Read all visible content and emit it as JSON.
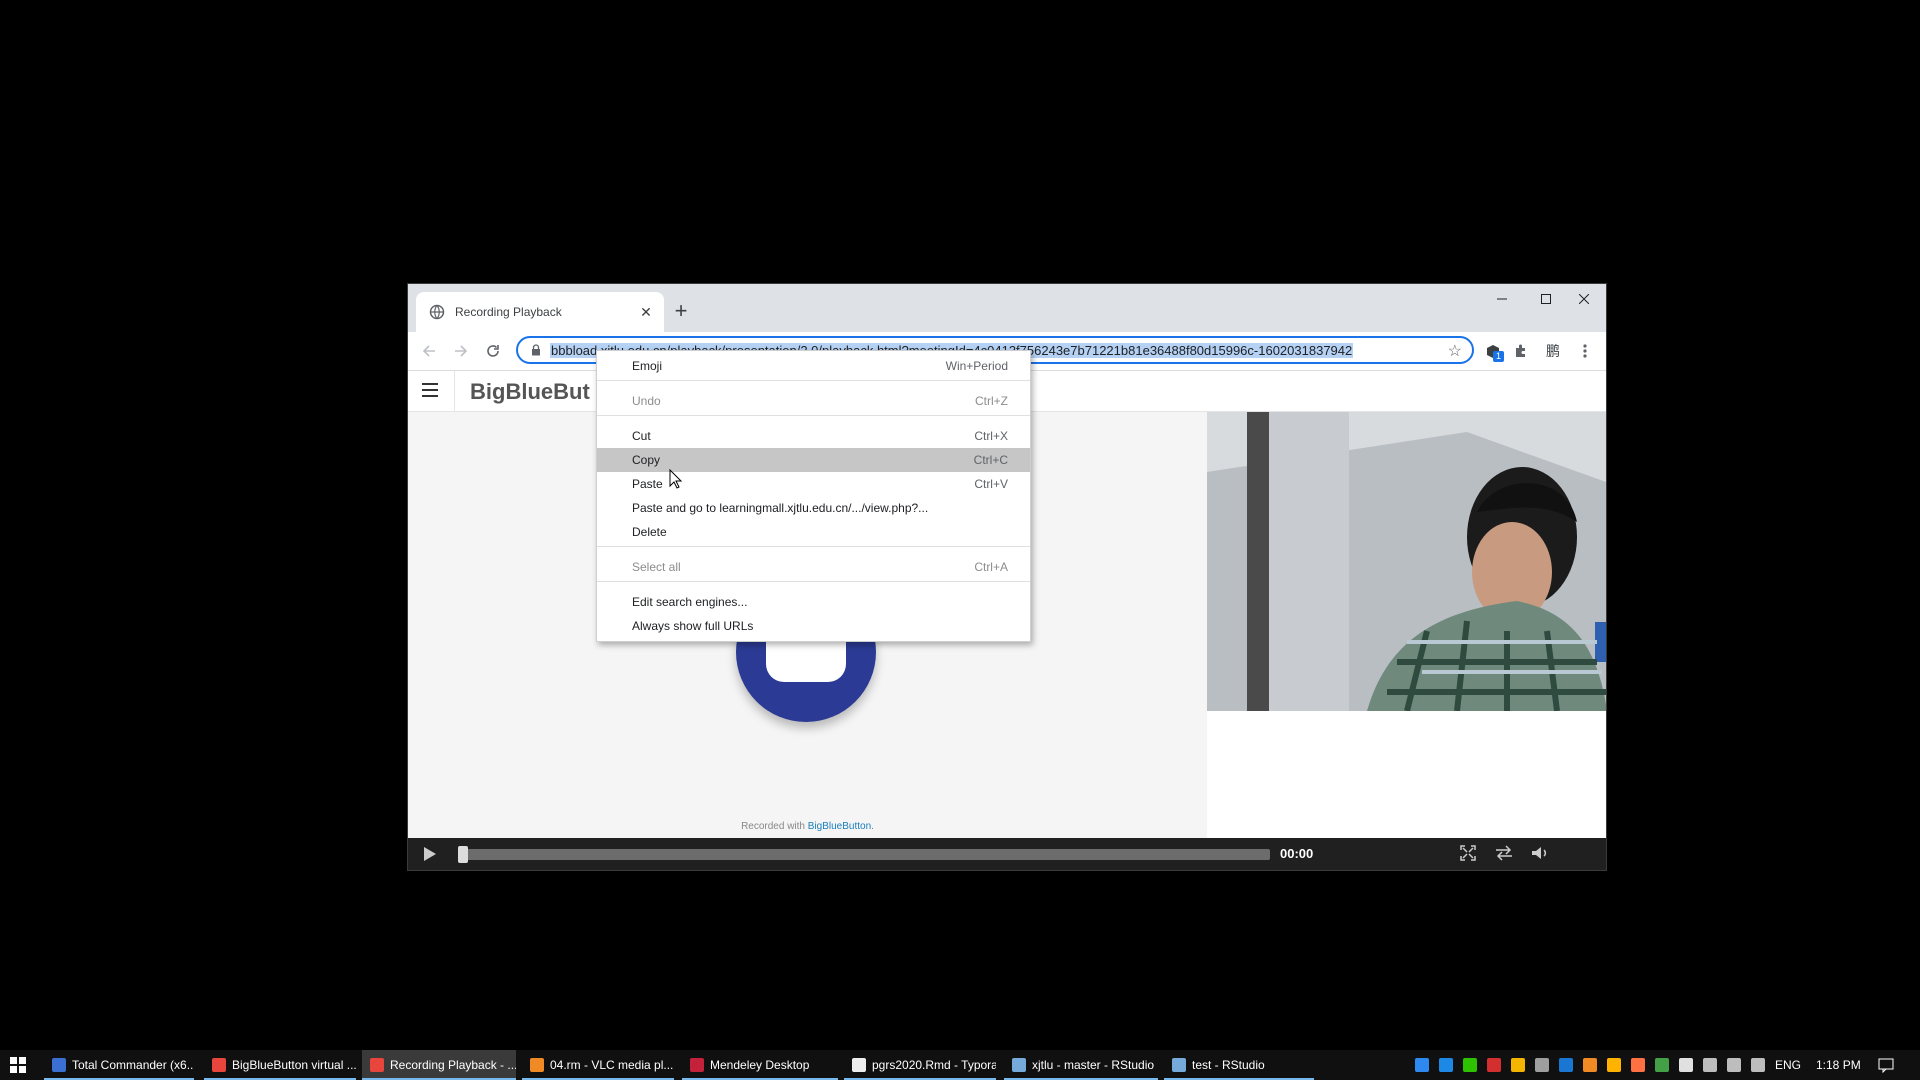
{
  "browser": {
    "tab_title": "Recording Playback",
    "tab_close": "✕",
    "new_tab": "+",
    "url": "bbbload.xjtlu.edu.cn/playback/presentation/2.0/playback.html?meetingId=4c0413f756243e7b71221b81e36488f80d15996c-1602031837942",
    "extension_badge": "1",
    "extension_ime": "鹏"
  },
  "page": {
    "brand": "BigBlueBut",
    "recorded_prefix": "Recorded with ",
    "recorded_link": "BigBlueButton",
    "recorded_suffix": ".",
    "time": "00:00",
    "progress": 0.0
  },
  "context_menu": {
    "items": [
      {
        "label": "Emoji",
        "shortcut": "Win+Period"
      },
      {
        "label": "Undo",
        "shortcut": "Ctrl+Z"
      },
      {
        "label": "Cut",
        "shortcut": "Ctrl+X"
      },
      {
        "label": "Copy",
        "shortcut": "Ctrl+C"
      },
      {
        "label": "Paste",
        "shortcut": "Ctrl+V"
      },
      {
        "label": "Paste and go to learningmall.xjtlu.edu.cn/.../view.php?...",
        "shortcut": ""
      },
      {
        "label": "Delete",
        "shortcut": ""
      },
      {
        "label": "Select all",
        "shortcut": "Ctrl+A"
      },
      {
        "label": "Edit search engines...",
        "shortcut": ""
      },
      {
        "label": "Always show full URLs",
        "shortcut": ""
      }
    ]
  },
  "taskbar": {
    "tasks": [
      {
        "label": "Total Commander (x6...",
        "icon": "total-commander-icon",
        "color": "#3b6fd1"
      },
      {
        "label": "BigBlueButton virtual ...",
        "icon": "chrome-icon",
        "color": "#e8453c"
      },
      {
        "label": "Recording Playback - ...",
        "icon": "chrome-icon",
        "color": "#e8453c"
      },
      {
        "label": "04.rm - VLC media pl...",
        "icon": "vlc-icon",
        "color": "#f08a24"
      },
      {
        "label": "Mendeley Desktop",
        "icon": "mendeley-icon",
        "color": "#c4223a"
      },
      {
        "label": "pgrs2020.Rmd - Typora",
        "icon": "typora-icon",
        "color": "#eeeeee"
      },
      {
        "label": "xjtlu - master - RStudio",
        "icon": "rstudio-icon",
        "color": "#75aadb"
      },
      {
        "label": "test - RStudio",
        "icon": "rstudio-icon",
        "color": "#75aadb"
      }
    ],
    "language": "ENG",
    "clock": "1:18 PM"
  }
}
